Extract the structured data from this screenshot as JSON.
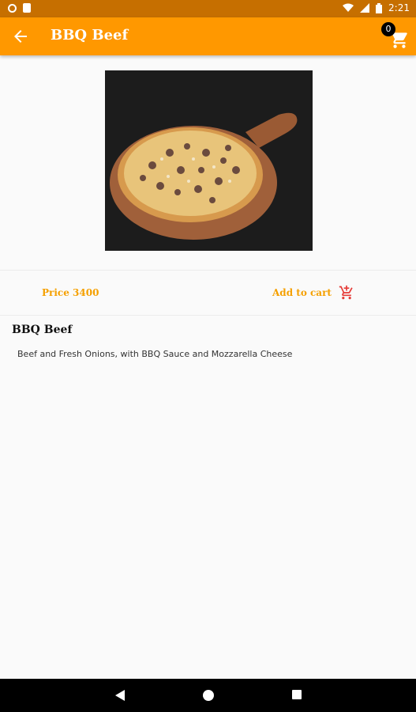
{
  "status_bar": {
    "time": "2:21"
  },
  "app_bar": {
    "title": "BBQ Beef",
    "cart_count": "0"
  },
  "product": {
    "price_label": "Price 3400",
    "add_to_cart_label": "Add to cart",
    "name": "BBQ Beef",
    "description": "Beef and Fresh Onions, with BBQ Sauce and Mozzarella Cheese"
  },
  "colors": {
    "accent": "#ff9800",
    "status": "#c66f00",
    "cart_icon": "#e53935"
  },
  "icons": [
    "back-arrow-icon",
    "cart-icon",
    "add-to-cart-icon",
    "wifi-icon",
    "signal-icon",
    "battery-icon"
  ]
}
